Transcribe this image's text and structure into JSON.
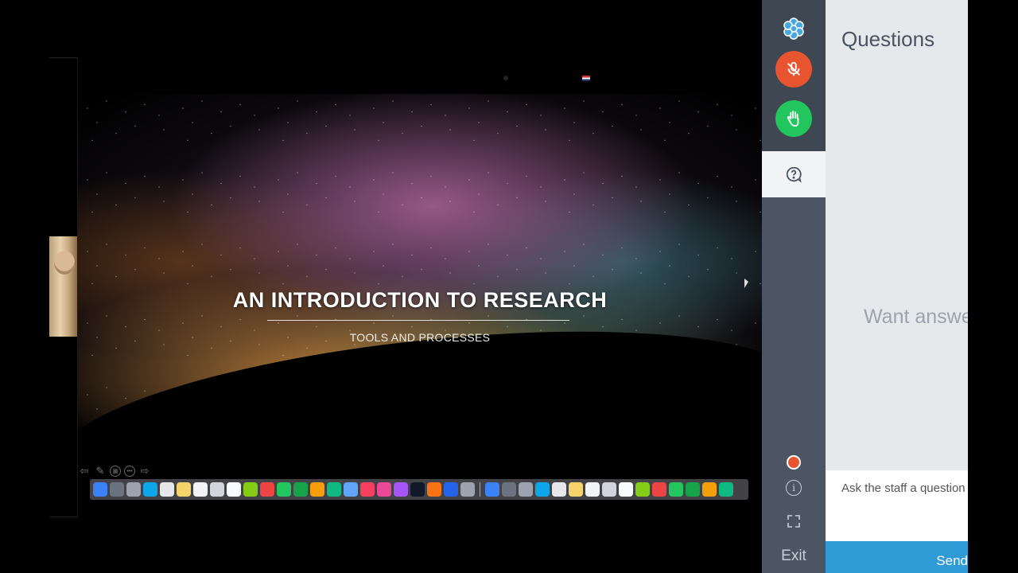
{
  "slide": {
    "title": "AN INTRODUCTION TO RESEARCH",
    "subtitle": "TOOLS AND PROCESSES"
  },
  "sidebar": {
    "logo_icon": "flower-logo-icon",
    "mic_icon": "microphone-muted-icon",
    "hand_icon": "raise-hand-icon",
    "questions_icon": "question-bubble-icon",
    "record_icon": "recording-dot-icon",
    "info_icon": "info-icon",
    "expand_icon": "expand-icon",
    "exit_label": "Exit"
  },
  "questions_panel": {
    "title": "Questions",
    "empty_text": "Want answe",
    "input_placeholder": "Ask the staff a question",
    "send_label": "Send"
  },
  "colors": {
    "mic_button": "#e8542f",
    "hand_button": "#22c55e",
    "send_button": "#2f9bd6",
    "rail": "#4b5563"
  },
  "dock_apps": [
    "finder",
    "siri",
    "launchpad",
    "safari",
    "photos",
    "notes",
    "calendar",
    "contacts",
    "reminders",
    "maps",
    "chrome",
    "messages",
    "facetime",
    "pages",
    "numbers",
    "keynote",
    "news",
    "music",
    "podcasts",
    "tv",
    "books",
    "app-store",
    "system-preferences",
    "chrome",
    "acrobat",
    "excel",
    "word",
    "zoom",
    "skype",
    "whatsapp",
    "archive",
    "viber",
    "preview",
    "powerpoint",
    "teams",
    "dropbox",
    "photos-alt",
    "trash"
  ]
}
